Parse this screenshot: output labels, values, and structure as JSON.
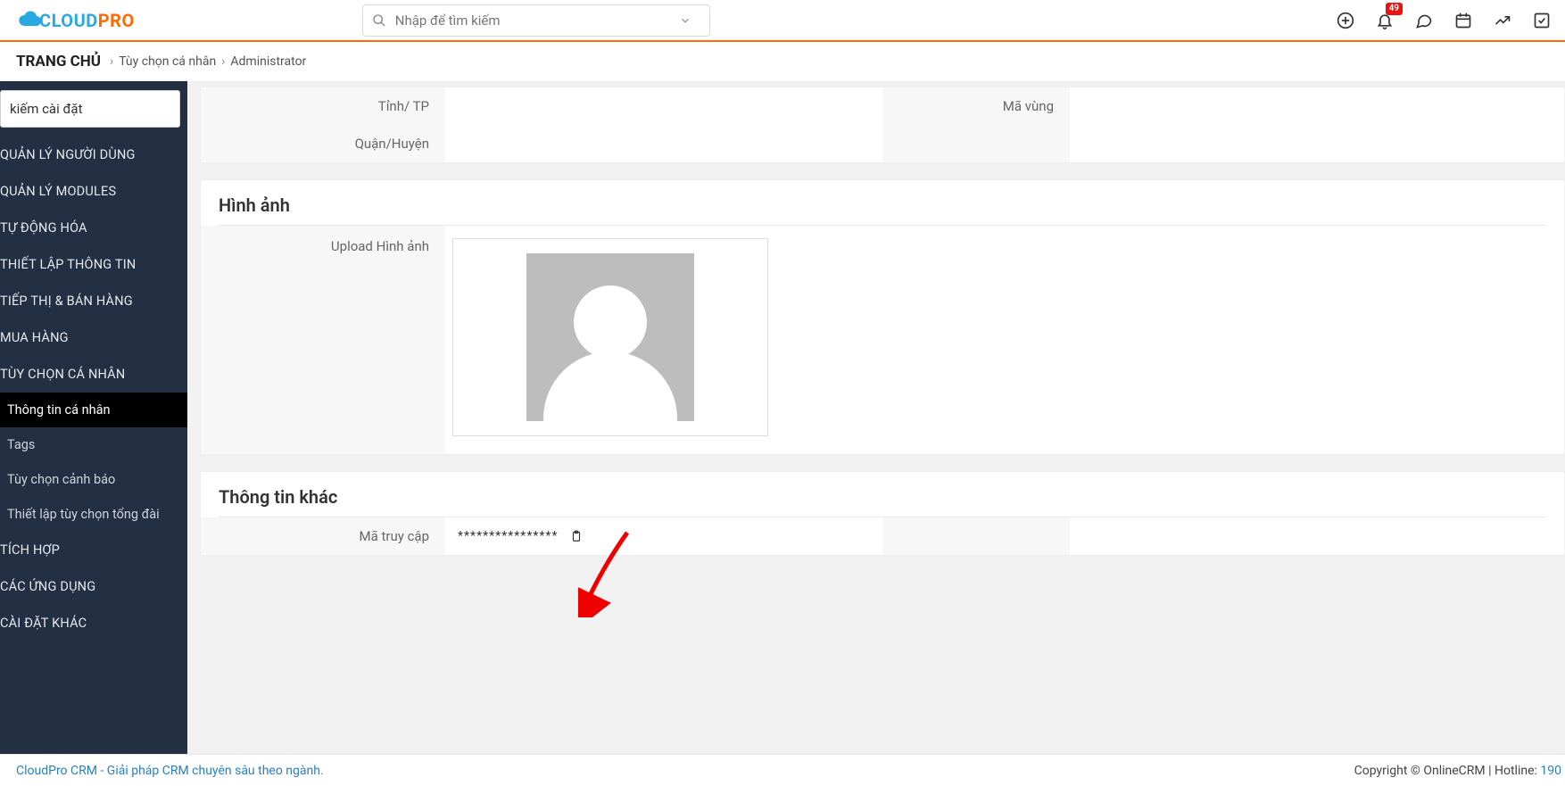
{
  "header": {
    "logo_text1": "CLOUD",
    "logo_text2": "PRO",
    "search_placeholder": "Nhập để tìm kiếm",
    "notification_count": "49"
  },
  "breadcrumb": {
    "home": "TRANG CHỦ",
    "item1": "Tùy chọn cá nhân",
    "item2": "Administrator"
  },
  "sidebar": {
    "search_placeholder": "kiếm cài đặt",
    "items": [
      "QUẢN LÝ NGƯỜI DÙNG",
      "QUẢN LÝ MODULES",
      "TỰ ĐỘNG HÓA",
      "THIẾT LẬP THÔNG TIN",
      "TIẾP THỊ & BÁN HÀNG",
      "MUA HÀNG",
      "TÙY CHỌN CÁ NHÂN"
    ],
    "sub_items": [
      "Thông tin cá nhân",
      "Tags",
      "Tùy chọn cảnh báo",
      "Thiết lập tùy chọn tổng đài"
    ],
    "items2": [
      "TÍCH HỢP",
      "CÁC ỨNG DỤNG",
      "CÀI ĐẶT KHÁC"
    ]
  },
  "panel1": {
    "label_tinhtp": "Tỉnh/ TP",
    "label_quanhuyen": "Quận/Huyện",
    "label_mavung": "Mã vùng"
  },
  "panel2": {
    "title": "Hình ảnh",
    "upload_label": "Upload Hình ảnh"
  },
  "panel3": {
    "title": "Thông tin khác",
    "label_matruycap": "Mã truy cập",
    "value_matruycap": "****************"
  },
  "footer": {
    "left": "CloudPro CRM - Giải pháp CRM chuyên sâu theo ngành.",
    "right_prefix": "Copyright © OnlineCRM | Hotline: ",
    "right_tel": "190"
  }
}
